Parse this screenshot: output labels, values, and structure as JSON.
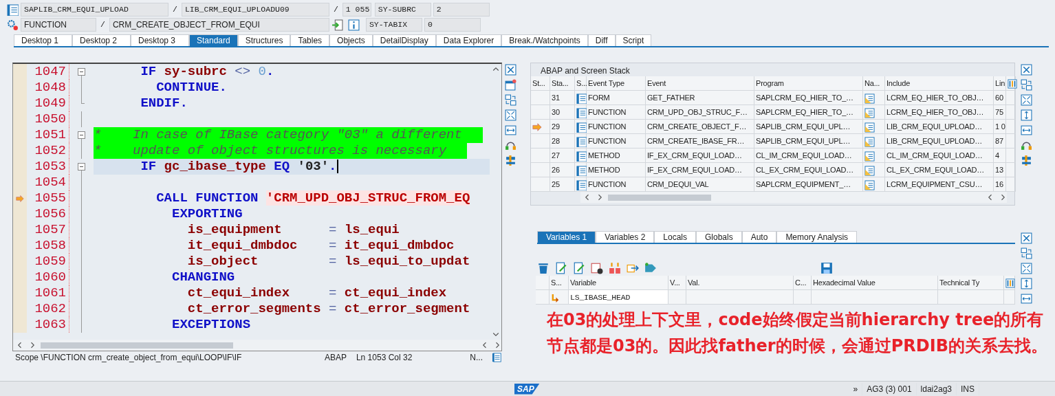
{
  "header": {
    "program": "SAPLIB_CRM_EQUI_UPLOAD",
    "separator_1": "/",
    "include": "LIB_CRM_EQUI_UPLOADU09",
    "separator_2": "/",
    "line": "1 055",
    "event_type": "FUNCTION",
    "separator_3": "/",
    "event": "CRM_CREATE_OBJECT_FROM_EQUI"
  },
  "system_fields": [
    {
      "name": "SY-SUBRC",
      "value": "2"
    },
    {
      "name": "SY-TABIX",
      "value": "0"
    }
  ],
  "tabs": [
    {
      "label": "Desktop 1",
      "selected": false
    },
    {
      "label": "Desktop 2",
      "selected": false
    },
    {
      "label": "Desktop 3",
      "selected": false
    },
    {
      "label": "Standard",
      "selected": true
    },
    {
      "label": "Structures",
      "selected": false
    },
    {
      "label": "Tables",
      "selected": false
    },
    {
      "label": "Objects",
      "selected": false
    },
    {
      "label": "DetailDisplay",
      "selected": false
    },
    {
      "label": "Data Explorer",
      "selected": false
    },
    {
      "label": "Break./Watchpoints",
      "selected": false
    },
    {
      "label": "Diff",
      "selected": false
    },
    {
      "label": "Script",
      "selected": false
    }
  ],
  "editor": {
    "lines": [
      {
        "number": "1047",
        "execution_point": false,
        "cursor_line": false,
        "fold_start": true,
        "fold_end": false,
        "tokens": [
          {
            "kind": "keyword",
            "text": "      IF"
          },
          {
            "kind": "variable",
            "text": " sy-subrc"
          },
          {
            "kind": "operator",
            "text": " <>"
          },
          {
            "kind": "number",
            "text": " 0"
          },
          {
            "kind": "keyword",
            "text": "."
          }
        ]
      },
      {
        "number": "1048",
        "execution_point": false,
        "cursor_line": false,
        "fold_start": false,
        "fold_end": false,
        "tokens": [
          {
            "kind": "keyword",
            "text": "        CONTINUE."
          }
        ]
      },
      {
        "number": "1049",
        "execution_point": false,
        "cursor_line": false,
        "fold_start": false,
        "fold_end": true,
        "tokens": [
          {
            "kind": "keyword",
            "text": "      ENDIF."
          }
        ]
      },
      {
        "number": "1050",
        "execution_point": false,
        "cursor_line": false,
        "fold_start": false,
        "fold_end": false
      },
      {
        "number": "1051",
        "execution_point": false,
        "cursor_line": false,
        "fold_start": true,
        "fold_end": false,
        "tokens": [
          {
            "kind": "comment",
            "text": "*    In case of IBase category \"03\" a different"
          }
        ]
      },
      {
        "number": "1052",
        "execution_point": false,
        "cursor_line": false,
        "fold_start": false,
        "fold_end": false,
        "tokens": [
          {
            "kind": "comment",
            "text": "*    update of object structures is necessary"
          }
        ]
      },
      {
        "number": "1053",
        "execution_point": false,
        "cursor_line": true,
        "fold_start": true,
        "fold_end": false,
        "tokens": [
          {
            "kind": "keyword",
            "text": "      IF"
          },
          {
            "kind": "variable",
            "text": " gc_ibase_type"
          },
          {
            "kind": "keyword",
            "text": " EQ"
          },
          {
            "kind": "literal",
            "text": " '03'"
          },
          {
            "kind": "keyword",
            "text": "."
          }
        ]
      },
      {
        "number": "1054",
        "execution_point": false,
        "cursor_line": false,
        "fold_start": false,
        "fold_end": false
      },
      {
        "number": "1055",
        "execution_point": true,
        "cursor_line": false,
        "fold_start": false,
        "fold_end": false,
        "tokens": [
          {
            "kind": "keyword",
            "text": "        CALL FUNCTION "
          },
          {
            "kind": "string",
            "text": "'CRM_UPD_OBJ_STRUC_FROM_EQ"
          }
        ]
      },
      {
        "number": "1056",
        "execution_point": false,
        "cursor_line": false,
        "fold_start": false,
        "fold_end": false,
        "tokens": [
          {
            "kind": "keyword",
            "text": "          EXPORTING"
          }
        ]
      },
      {
        "number": "1057",
        "execution_point": false,
        "cursor_line": false,
        "fold_start": false,
        "fold_end": false,
        "tokens": [
          {
            "kind": "variable",
            "text": "            is_equipment"
          },
          {
            "kind": "operator",
            "text": "      ="
          },
          {
            "kind": "variable",
            "text": " ls_equi"
          }
        ]
      },
      {
        "number": "1058",
        "execution_point": false,
        "cursor_line": false,
        "fold_start": false,
        "fold_end": false,
        "tokens": [
          {
            "kind": "variable",
            "text": "            it_equi_dmbdoc"
          },
          {
            "kind": "operator",
            "text": "    ="
          },
          {
            "kind": "variable",
            "text": " it_equi_dmbdoc"
          }
        ]
      },
      {
        "number": "1059",
        "execution_point": false,
        "cursor_line": false,
        "fold_start": false,
        "fold_end": false,
        "tokens": [
          {
            "kind": "variable",
            "text": "            is_object"
          },
          {
            "kind": "operator",
            "text": "         ="
          },
          {
            "kind": "variable",
            "text": " ls_equi_to_updat"
          }
        ]
      },
      {
        "number": "1060",
        "execution_point": false,
        "cursor_line": false,
        "fold_start": false,
        "fold_end": false,
        "tokens": [
          {
            "kind": "keyword",
            "text": "          CHANGING"
          }
        ]
      },
      {
        "number": "1061",
        "execution_point": false,
        "cursor_line": false,
        "fold_start": false,
        "fold_end": false,
        "tokens": [
          {
            "kind": "variable",
            "text": "            ct_equi_index"
          },
          {
            "kind": "operator",
            "text": "     ="
          },
          {
            "kind": "variable",
            "text": " ct_equi_index"
          }
        ]
      },
      {
        "number": "1062",
        "execution_point": false,
        "cursor_line": false,
        "fold_start": false,
        "fold_end": false,
        "tokens": [
          {
            "kind": "variable",
            "text": "            ct_error_segments"
          },
          {
            "kind": "operator",
            "text": " ="
          },
          {
            "kind": "variable",
            "text": " ct_error_segment"
          }
        ]
      },
      {
        "number": "1063",
        "execution_point": false,
        "cursor_line": false,
        "fold_start": false,
        "fold_end": false,
        "tokens": [
          {
            "kind": "keyword",
            "text": "          EXCEPTIONS"
          }
        ]
      }
    ],
    "status": {
      "scope": "Scope \\FUNCTION crm_create_object_from_equi\\LOOP\\IF\\IF",
      "language": "ABAP",
      "position": "Ln 1053 Col  32",
      "mode": "N..."
    }
  },
  "stack": {
    "title": "ABAP and Screen Stack",
    "columns": [
      "St...",
      "Sta...",
      "S...",
      "Event Type",
      "Event",
      "Program",
      "Na...",
      "Include",
      "Lin"
    ],
    "rows": [
      {
        "current": false,
        "level": "31",
        "event_type": "FORM",
        "event": "GET_FATHER",
        "program": "SAPLCRM_EQ_HIER_TO_…",
        "include": "LCRM_EQ_HIER_TO_OBJ…",
        "line": "60"
      },
      {
        "current": false,
        "level": "30",
        "event_type": "FUNCTION",
        "event": "CRM_UPD_OBJ_STRUC_F…",
        "program": "SAPLCRM_EQ_HIER_TO_…",
        "include": "LCRM_EQ_HIER_TO_OBJ…",
        "line": "75"
      },
      {
        "current": true,
        "level": "29",
        "event_type": "FUNCTION",
        "event": "CRM_CREATE_OBJECT_F…",
        "program": "SAPLIB_CRM_EQUI_UPL…",
        "include": "LIB_CRM_EQUI_UPLOAD…",
        "line": "1 0"
      },
      {
        "current": false,
        "level": "28",
        "event_type": "FUNCTION",
        "event": "CRM_CREATE_IBASE_FR…",
        "program": "SAPLIB_CRM_EQUI_UPL…",
        "include": "LIB_CRM_EQUI_UPLOAD…",
        "line": "87"
      },
      {
        "current": false,
        "level": "27",
        "event_type": "METHOD",
        "event": "IF_EX_CRM_EQUI_LOAD…",
        "program": "CL_IM_CRM_EQUI_LOAD…",
        "include": "CL_IM_CRM_EQUI_LOAD…",
        "line": "4"
      },
      {
        "current": false,
        "level": "26",
        "event_type": "METHOD",
        "event": "IF_EX_CRM_EQUI_LOAD…",
        "program": "CL_EX_CRM_EQUI_LOAD…",
        "include": "CL_EX_CRM_EQUI_LOAD…",
        "line": "13"
      },
      {
        "current": false,
        "level": "25",
        "event_type": "FUNCTION",
        "event": "CRM_DEQUI_VAL",
        "program": "SAPLCRM_EQUIPMENT_…",
        "include": "LCRM_EQUIPMENT_CSU…",
        "line": "16"
      }
    ]
  },
  "variables": {
    "tabs": [
      {
        "label": "Variables 1",
        "selected": true
      },
      {
        "label": "Variables 2",
        "selected": false
      },
      {
        "label": "Locals",
        "selected": false
      },
      {
        "label": "Globals",
        "selected": false
      },
      {
        "label": "Auto",
        "selected": false
      },
      {
        "label": "Memory Analysis",
        "selected": false
      }
    ],
    "columns": [
      "S...",
      "Variable",
      "V...",
      "Val.",
      "C...",
      "Hexadecimal Value",
      "Technical Ty"
    ],
    "rows": [
      {
        "variable": "LS_IBASE_HEAD"
      }
    ]
  },
  "annotation": "在03的处理上下文里，code始终假定当前hierarchy tree的所有节点都是03的。因此找father的时候，会通过PRDIB的关系去找。",
  "status_bar": {
    "logo": "SAP",
    "items": [
      "»",
      "AG3 (3) 001",
      "ldai2ag3",
      "INS"
    ]
  }
}
